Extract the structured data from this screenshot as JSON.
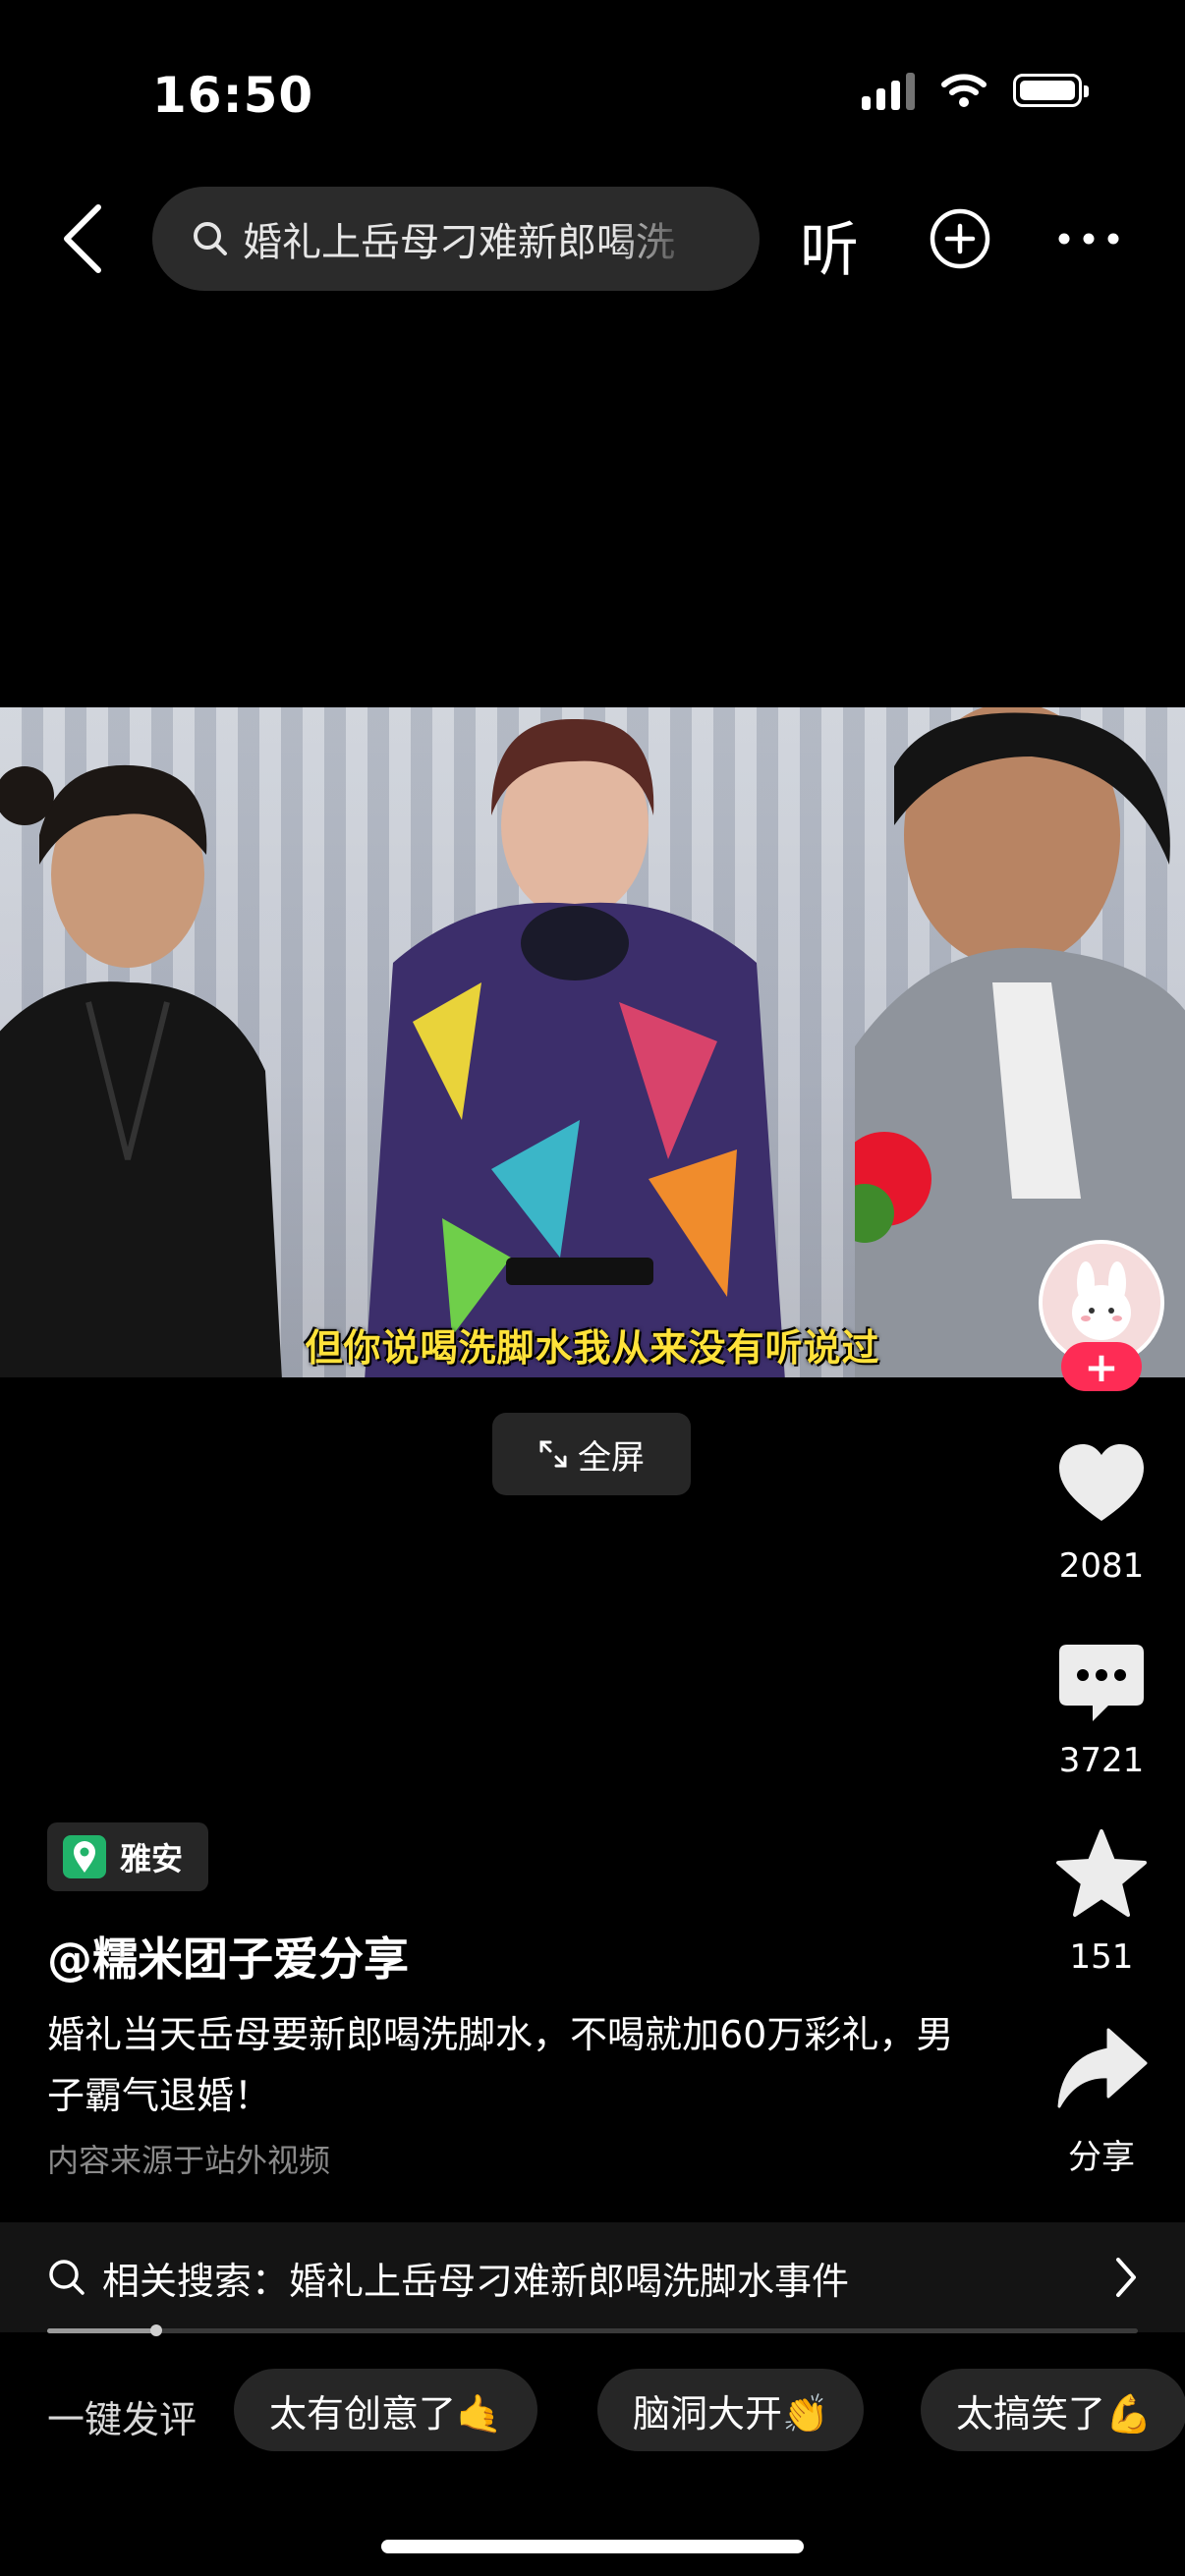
{
  "status_bar": {
    "time": "16:50"
  },
  "top_nav": {
    "search_query": "婚礼上岳母刁难新郎喝洗",
    "listen_label": "听"
  },
  "video": {
    "subtitle": "但你说喝洗脚水我从来没有听说过",
    "fullscreen_label": "全屏"
  },
  "rail": {
    "like_count": "2081",
    "comment_count": "3721",
    "favorite_count": "151",
    "share_label": "分享",
    "follow_symbol": "+"
  },
  "info": {
    "location": "雅安",
    "author": "@糯米团子爱分享",
    "description": "婚礼当天岳母要新郎喝洗脚水，不喝就加60万彩礼，男子霸气退婚！",
    "source_note": "内容来源于站外视频"
  },
  "related_search": {
    "text": "相关搜索：婚礼上岳母刁难新郎喝洗脚水事件",
    "progress": 0.1
  },
  "quick_comment": {
    "label": "一键发评",
    "chips": [
      "太有创意了🤙",
      "脑洞大开👏",
      "太搞笑了💪"
    ]
  },
  "colors": {
    "accent_red": "#fe2c55",
    "subtitle_yellow": "#ffe23a",
    "location_green": "#21b36a"
  }
}
